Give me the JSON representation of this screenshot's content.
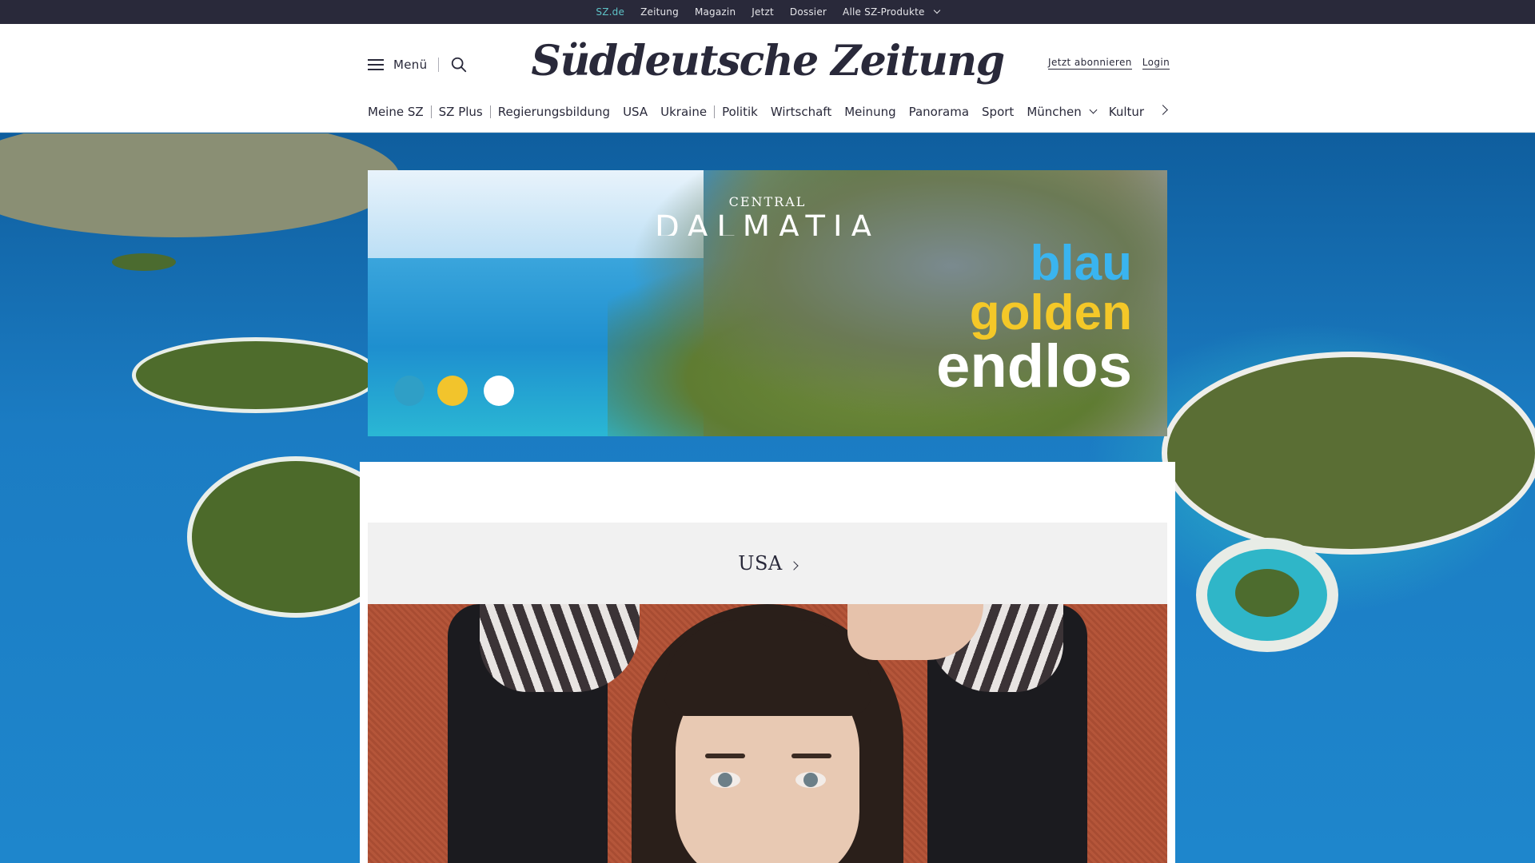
{
  "topbar": {
    "links": [
      "SZ.de",
      "Zeitung",
      "Magazin",
      "Jetzt",
      "Dossier",
      "Alle SZ-Produkte"
    ]
  },
  "header": {
    "menu_label": "Menü",
    "logo": "Süddeutsche Zeitung",
    "subscribe": "Jetzt abonnieren",
    "login": "Login"
  },
  "nav": {
    "items": [
      "Meine SZ",
      "SZ Plus",
      "Regierungsbildung",
      "USA",
      "Ukraine",
      "Politik",
      "Wirtschaft",
      "Meinung",
      "Panorama",
      "Sport",
      "München",
      "Kultur"
    ]
  },
  "ad": {
    "brand_small": "CENTRAL",
    "brand_big": "DALMATIA",
    "word1": "blau",
    "word2": "golden",
    "word3": "endlos",
    "colors": {
      "blue": "#3ab4ef",
      "gold": "#f4c828",
      "white": "#ffffff"
    }
  },
  "section": {
    "title": "USA"
  },
  "icons": [
    "hamburger-icon",
    "search-icon",
    "chevron-down-icon",
    "chevron-right-icon"
  ]
}
